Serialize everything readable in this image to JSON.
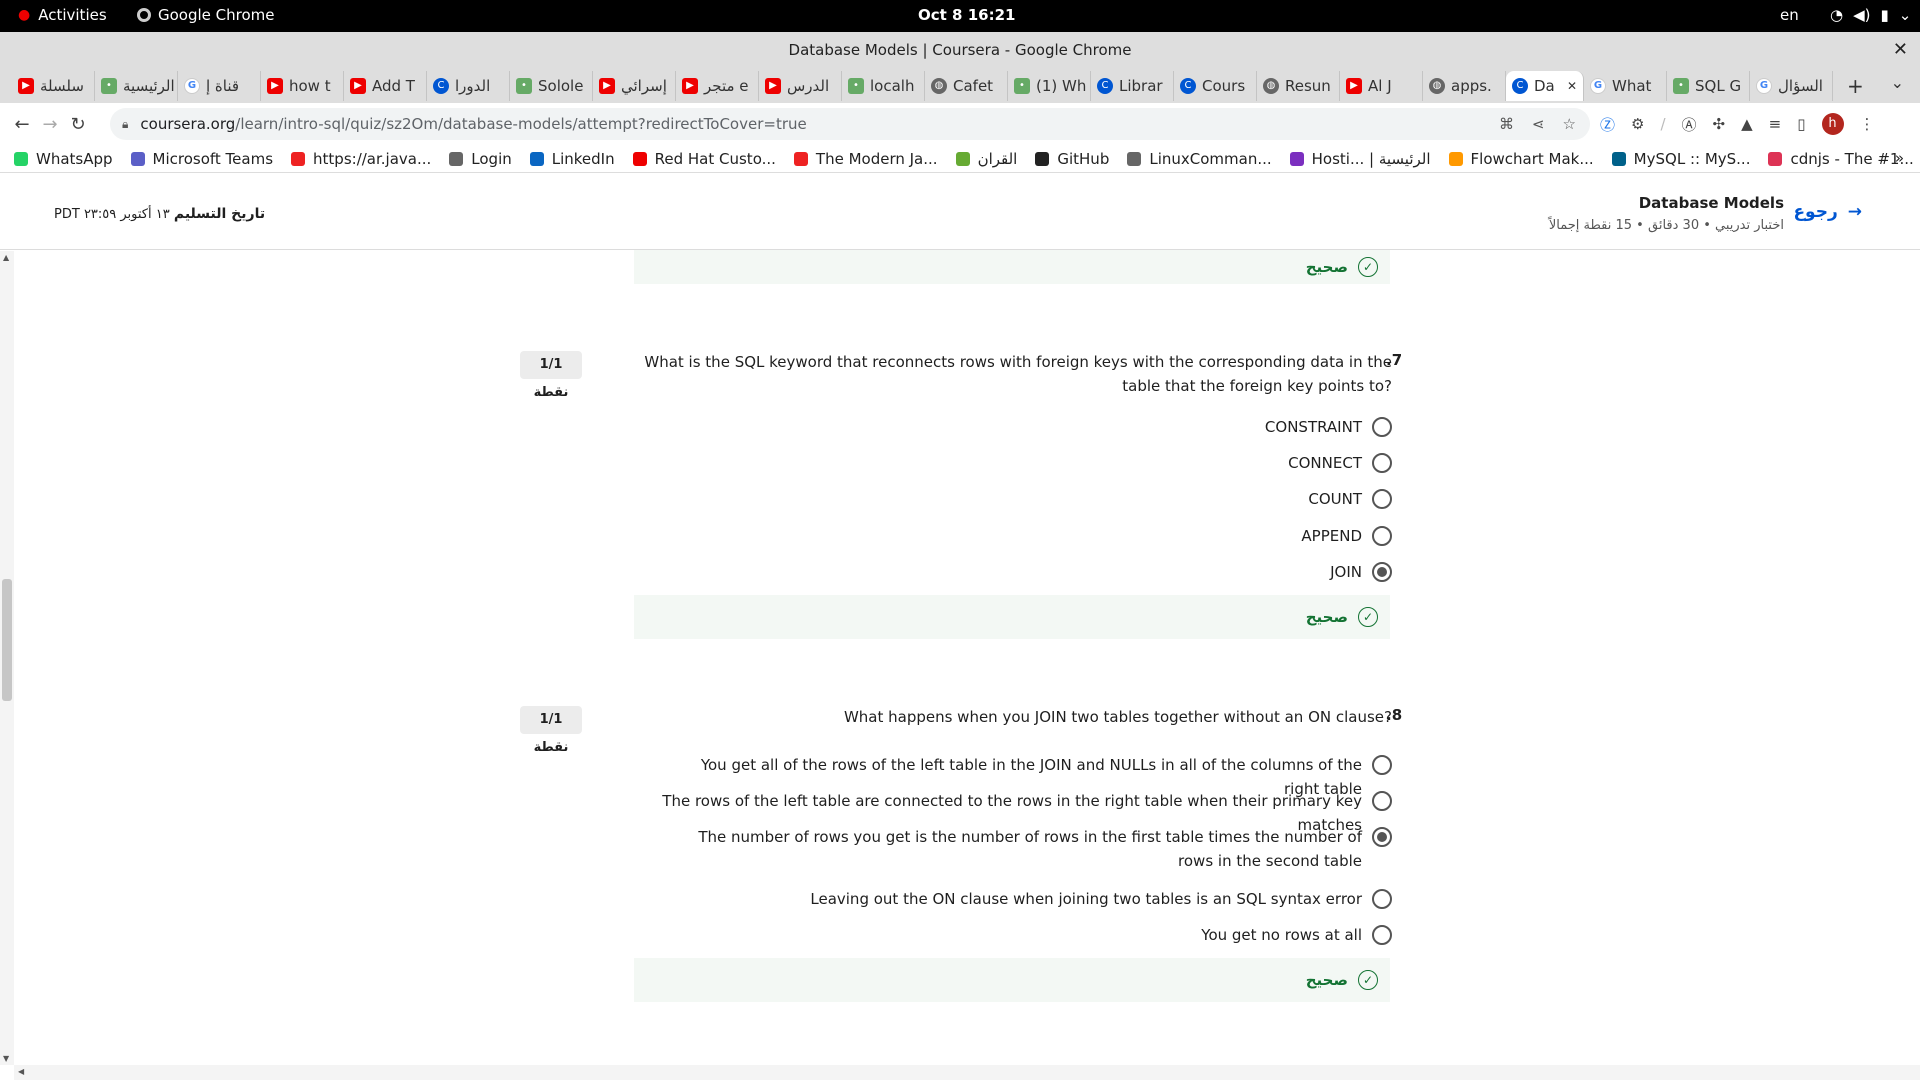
{
  "topbar": {
    "activities": "Activities",
    "app": "Google Chrome",
    "clock": "Oct 8  16:21",
    "lang": "en"
  },
  "window": {
    "title": "Database Models | Coursera - Google Chrome"
  },
  "tabs": [
    {
      "label": "سلسلة",
      "icon": "youtube"
    },
    {
      "label": "الرئيسية",
      "icon": "misc"
    },
    {
      "label": "قناة إ",
      "icon": "google"
    },
    {
      "label": "how t",
      "icon": "youtube"
    },
    {
      "label": "Add T",
      "icon": "youtube"
    },
    {
      "label": "الدورا",
      "icon": "coursera"
    },
    {
      "label": "Solole",
      "icon": "misc"
    },
    {
      "label": "إسرائي",
      "icon": "youtube"
    },
    {
      "label": "متجر e",
      "icon": "youtube"
    },
    {
      "label": "الدرس",
      "icon": "youtube"
    },
    {
      "label": "localh",
      "icon": "misc"
    },
    {
      "label": "Cafet",
      "icon": "globe"
    },
    {
      "label": "(1) Wh",
      "icon": "misc"
    },
    {
      "label": "Librar",
      "icon": "coursera"
    },
    {
      "label": "Cours",
      "icon": "coursera"
    },
    {
      "label": "Resun",
      "icon": "globe"
    },
    {
      "label": "Al J",
      "icon": "youtube"
    },
    {
      "label": "apps.",
      "icon": "globe"
    },
    {
      "label": "Da",
      "icon": "coursera",
      "active": true
    },
    {
      "label": "What",
      "icon": "google"
    },
    {
      "label": "SQL G",
      "icon": "misc"
    },
    {
      "label": "السؤال",
      "icon": "google"
    }
  ],
  "address": {
    "host": "coursera.org",
    "path": "/learn/intro-sql/quiz/sz2Om/database-models/attempt?redirectToCover=true"
  },
  "profile_letter": "h",
  "bookmarks": [
    {
      "label": "WhatsApp",
      "color": "#25d366"
    },
    {
      "label": "Microsoft Teams",
      "color": "#5b5fc7"
    },
    {
      "label": "https://ar.java...",
      "color": "#e22"
    },
    {
      "label": "Login",
      "color": "#666"
    },
    {
      "label": "LinkedIn",
      "color": "#0a66c2"
    },
    {
      "label": "Red Hat Custo...",
      "color": "#e00"
    },
    {
      "label": "The Modern Ja...",
      "color": "#e22"
    },
    {
      "label": "القران",
      "color": "#6a3"
    },
    {
      "label": "GitHub",
      "color": "#222"
    },
    {
      "label": "LinuxComman...",
      "color": "#666"
    },
    {
      "label": "Hosti... | الرئيسية",
      "color": "#7b2fbf"
    },
    {
      "label": "Flowchart Mak...",
      "color": "#f90"
    },
    {
      "label": "MySQL :: MyS...",
      "color": "#00618a"
    },
    {
      "label": "cdnjs - The #1...",
      "color": "#d35"
    }
  ],
  "header": {
    "back": "رجوع",
    "title": "Database Models",
    "subtitle": "اختبار تدريبي • 30 دقائق • 15 نقطة إجمالاً",
    "due_label": "تاريخ التسليم",
    "due_value": "١٣ أكتوبر ٢٣:٥٩ PDT"
  },
  "feedback_label": "صحيح",
  "questions": [
    {
      "num": ".7",
      "points": "1/1 نقطة",
      "text": "What is the SQL keyword that reconnects rows with foreign keys with the corresponding data in the table that the foreign key points to?",
      "options": [
        "CONSTRAINT",
        "CONNECT",
        "COUNT",
        "APPEND",
        "JOIN"
      ],
      "selected": 4
    },
    {
      "num": ".8",
      "points": "1/1 نقطة",
      "text": "What happens when you JOIN two tables together without an ON clause?",
      "options": [
        "You get all of the rows of the left table in the JOIN and NULLs in all of the columns of the right table",
        "The rows of the left table are connected to the rows in the right table when their primary key matches",
        "The number of rows you get is the number of rows in the first table times the number of rows in the second table",
        "Leaving out the ON clause when joining two tables is an SQL syntax error",
        "You get no rows at all"
      ],
      "selected": 2
    }
  ]
}
